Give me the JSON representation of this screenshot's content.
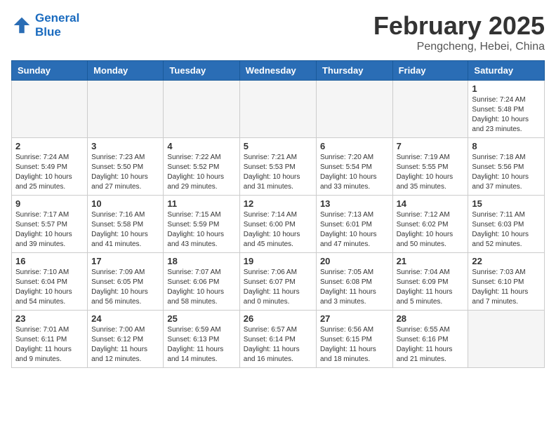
{
  "header": {
    "logo_line1": "General",
    "logo_line2": "Blue",
    "month": "February 2025",
    "location": "Pengcheng, Hebei, China"
  },
  "weekdays": [
    "Sunday",
    "Monday",
    "Tuesday",
    "Wednesday",
    "Thursday",
    "Friday",
    "Saturday"
  ],
  "weeks": [
    [
      {
        "day": "",
        "info": ""
      },
      {
        "day": "",
        "info": ""
      },
      {
        "day": "",
        "info": ""
      },
      {
        "day": "",
        "info": ""
      },
      {
        "day": "",
        "info": ""
      },
      {
        "day": "",
        "info": ""
      },
      {
        "day": "1",
        "info": "Sunrise: 7:24 AM\nSunset: 5:48 PM\nDaylight: 10 hours and 23 minutes."
      }
    ],
    [
      {
        "day": "2",
        "info": "Sunrise: 7:24 AM\nSunset: 5:49 PM\nDaylight: 10 hours and 25 minutes."
      },
      {
        "day": "3",
        "info": "Sunrise: 7:23 AM\nSunset: 5:50 PM\nDaylight: 10 hours and 27 minutes."
      },
      {
        "day": "4",
        "info": "Sunrise: 7:22 AM\nSunset: 5:52 PM\nDaylight: 10 hours and 29 minutes."
      },
      {
        "day": "5",
        "info": "Sunrise: 7:21 AM\nSunset: 5:53 PM\nDaylight: 10 hours and 31 minutes."
      },
      {
        "day": "6",
        "info": "Sunrise: 7:20 AM\nSunset: 5:54 PM\nDaylight: 10 hours and 33 minutes."
      },
      {
        "day": "7",
        "info": "Sunrise: 7:19 AM\nSunset: 5:55 PM\nDaylight: 10 hours and 35 minutes."
      },
      {
        "day": "8",
        "info": "Sunrise: 7:18 AM\nSunset: 5:56 PM\nDaylight: 10 hours and 37 minutes."
      }
    ],
    [
      {
        "day": "9",
        "info": "Sunrise: 7:17 AM\nSunset: 5:57 PM\nDaylight: 10 hours and 39 minutes."
      },
      {
        "day": "10",
        "info": "Sunrise: 7:16 AM\nSunset: 5:58 PM\nDaylight: 10 hours and 41 minutes."
      },
      {
        "day": "11",
        "info": "Sunrise: 7:15 AM\nSunset: 5:59 PM\nDaylight: 10 hours and 43 minutes."
      },
      {
        "day": "12",
        "info": "Sunrise: 7:14 AM\nSunset: 6:00 PM\nDaylight: 10 hours and 45 minutes."
      },
      {
        "day": "13",
        "info": "Sunrise: 7:13 AM\nSunset: 6:01 PM\nDaylight: 10 hours and 47 minutes."
      },
      {
        "day": "14",
        "info": "Sunrise: 7:12 AM\nSunset: 6:02 PM\nDaylight: 10 hours and 50 minutes."
      },
      {
        "day": "15",
        "info": "Sunrise: 7:11 AM\nSunset: 6:03 PM\nDaylight: 10 hours and 52 minutes."
      }
    ],
    [
      {
        "day": "16",
        "info": "Sunrise: 7:10 AM\nSunset: 6:04 PM\nDaylight: 10 hours and 54 minutes."
      },
      {
        "day": "17",
        "info": "Sunrise: 7:09 AM\nSunset: 6:05 PM\nDaylight: 10 hours and 56 minutes."
      },
      {
        "day": "18",
        "info": "Sunrise: 7:07 AM\nSunset: 6:06 PM\nDaylight: 10 hours and 58 minutes."
      },
      {
        "day": "19",
        "info": "Sunrise: 7:06 AM\nSunset: 6:07 PM\nDaylight: 11 hours and 0 minutes."
      },
      {
        "day": "20",
        "info": "Sunrise: 7:05 AM\nSunset: 6:08 PM\nDaylight: 11 hours and 3 minutes."
      },
      {
        "day": "21",
        "info": "Sunrise: 7:04 AM\nSunset: 6:09 PM\nDaylight: 11 hours and 5 minutes."
      },
      {
        "day": "22",
        "info": "Sunrise: 7:03 AM\nSunset: 6:10 PM\nDaylight: 11 hours and 7 minutes."
      }
    ],
    [
      {
        "day": "23",
        "info": "Sunrise: 7:01 AM\nSunset: 6:11 PM\nDaylight: 11 hours and 9 minutes."
      },
      {
        "day": "24",
        "info": "Sunrise: 7:00 AM\nSunset: 6:12 PM\nDaylight: 11 hours and 12 minutes."
      },
      {
        "day": "25",
        "info": "Sunrise: 6:59 AM\nSunset: 6:13 PM\nDaylight: 11 hours and 14 minutes."
      },
      {
        "day": "26",
        "info": "Sunrise: 6:57 AM\nSunset: 6:14 PM\nDaylight: 11 hours and 16 minutes."
      },
      {
        "day": "27",
        "info": "Sunrise: 6:56 AM\nSunset: 6:15 PM\nDaylight: 11 hours and 18 minutes."
      },
      {
        "day": "28",
        "info": "Sunrise: 6:55 AM\nSunset: 6:16 PM\nDaylight: 11 hours and 21 minutes."
      },
      {
        "day": "",
        "info": ""
      }
    ]
  ]
}
